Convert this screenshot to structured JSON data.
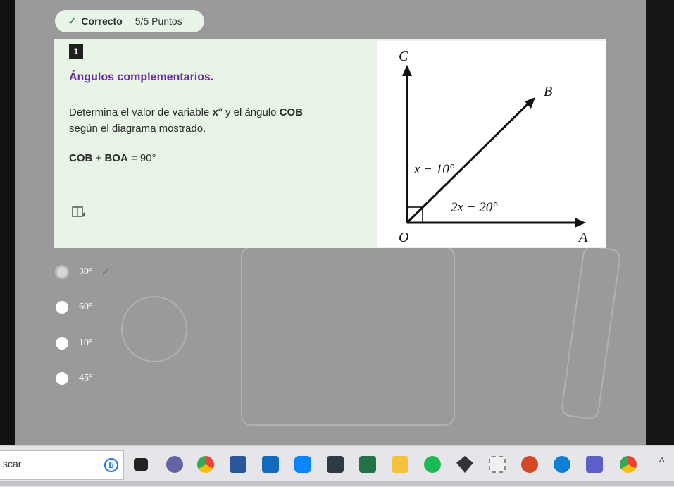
{
  "status": {
    "correct_label": "Correcto",
    "points": "5/5 Puntos"
  },
  "question": {
    "number": "1",
    "title": "Ángulos complementarios.",
    "text_part1": "Determina el valor de variable ",
    "text_var": "x°",
    "text_part2": " y el ángulo ",
    "text_angle": "COB",
    "text_part3": " según el diagrama mostrado.",
    "eq_a": "COB",
    "eq_plus": "+",
    "eq_b": "BOA",
    "eq_rest": "= 90°"
  },
  "diagram": {
    "label_c": "C",
    "label_b": "B",
    "label_o": "O",
    "label_a": "A",
    "angle_upper": "x − 10°",
    "angle_lower": "2x − 20°"
  },
  "options": [
    {
      "label": "30°",
      "selected": true,
      "correct_mark": "✓"
    },
    {
      "label": "60°",
      "selected": false
    },
    {
      "label": "10°",
      "selected": false
    },
    {
      "label": "45°",
      "selected": false
    }
  ],
  "taskbar": {
    "search_text": "scar",
    "bing_label": "b"
  },
  "colors": {
    "title_purple": "#6b2f9b",
    "card_green": "#e8f4e6",
    "check_green": "#3a8f3a"
  }
}
